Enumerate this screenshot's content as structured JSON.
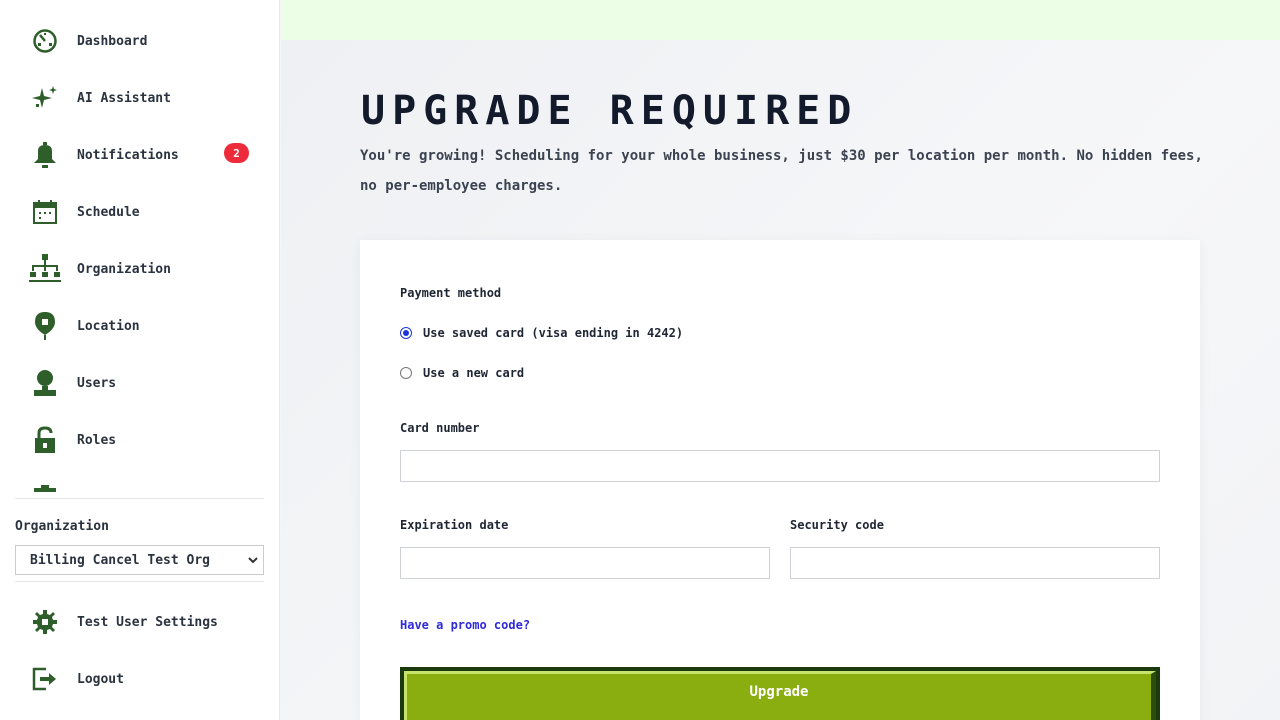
{
  "sidebar": {
    "items": [
      {
        "label": "Dashboard",
        "icon": "dashboard-icon"
      },
      {
        "label": "AI Assistant",
        "icon": "sparkle-icon"
      },
      {
        "label": "Notifications",
        "icon": "bell-icon",
        "badge": "2"
      },
      {
        "label": "Schedule",
        "icon": "calendar-icon"
      },
      {
        "label": "Organization",
        "icon": "org-chart-icon"
      },
      {
        "label": "Location",
        "icon": "map-pin-icon"
      },
      {
        "label": "Users",
        "icon": "user-icon"
      },
      {
        "label": "Roles",
        "icon": "lock-icon"
      }
    ],
    "organization_label": "Organization",
    "organization_selected": "Billing Cancel Test Org",
    "settings_label": "Test User Settings",
    "logout_label": "Logout"
  },
  "page": {
    "title": "UPGRADE REQUIRED",
    "subtitle": "You're growing! Scheduling for your whole business, just $30 per location per month. No hidden fees, no per-employee charges."
  },
  "form": {
    "payment_method_label": "Payment method",
    "option_saved": "Use saved card (visa ending in 4242)",
    "option_new": "Use a new card",
    "selected_option": "saved",
    "card_number_label": "Card number",
    "card_number_value": "",
    "expiration_label": "Expiration date",
    "expiration_value": "",
    "security_label": "Security code",
    "security_value": "",
    "promo_link": "Have a promo code?",
    "submit_label": "Upgrade"
  },
  "colors": {
    "icon_green": "#2e5e2a",
    "badge_red": "#ee2b3b",
    "topbar": "#ecffe6",
    "button_green": "#8aad0f",
    "link_blue": "#2f2adb"
  }
}
